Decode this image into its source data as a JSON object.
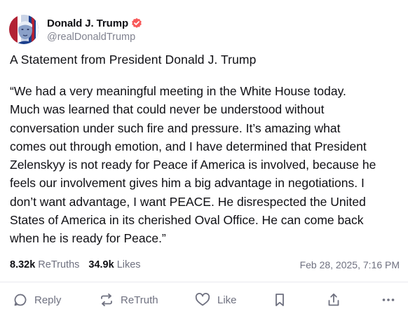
{
  "author": {
    "display_name": "Donald J. Trump",
    "handle": "@realDonaldTrump",
    "verified_color": "#f85a5a"
  },
  "post": {
    "title": "A Statement from President Donald J. Trump",
    "body_lines": [
      "“We had a very meaningful meeting in the White House today.",
      "Much was learned that could never be understood without",
      "conversation under such fire and pressure. It’s amazing what",
      "comes out through emotion, and I have determined that President",
      "Zelenskyy is not ready for Peace if America is involved, because he",
      "feels our involvement gives him a big advantage in negotiations. I",
      "don’t want advantage, I want PEACE. He disrespected the United",
      "States of America in its cherished Oval Office. He can come back",
      "when he is ready for Peace.”"
    ],
    "retruths_count": "8.32k",
    "retruths_label": "ReTruths",
    "likes_count": "34.9k",
    "likes_label": "Likes",
    "timestamp": "Feb 28, 2025, 7:16 PM"
  },
  "actions": {
    "reply": {
      "label": "Reply",
      "icon": "reply-icon"
    },
    "retruth": {
      "label": "ReTruth",
      "icon": "retruth-icon"
    },
    "like": {
      "label": "Like",
      "icon": "heart-icon"
    },
    "bookmark": {
      "icon": "bookmark-icon"
    },
    "share": {
      "icon": "share-icon"
    },
    "more": {
      "icon": "more-icon"
    }
  },
  "colors": {
    "text": "#0f0f14",
    "muted": "#6f7180",
    "divider": "#e9e9ee"
  }
}
